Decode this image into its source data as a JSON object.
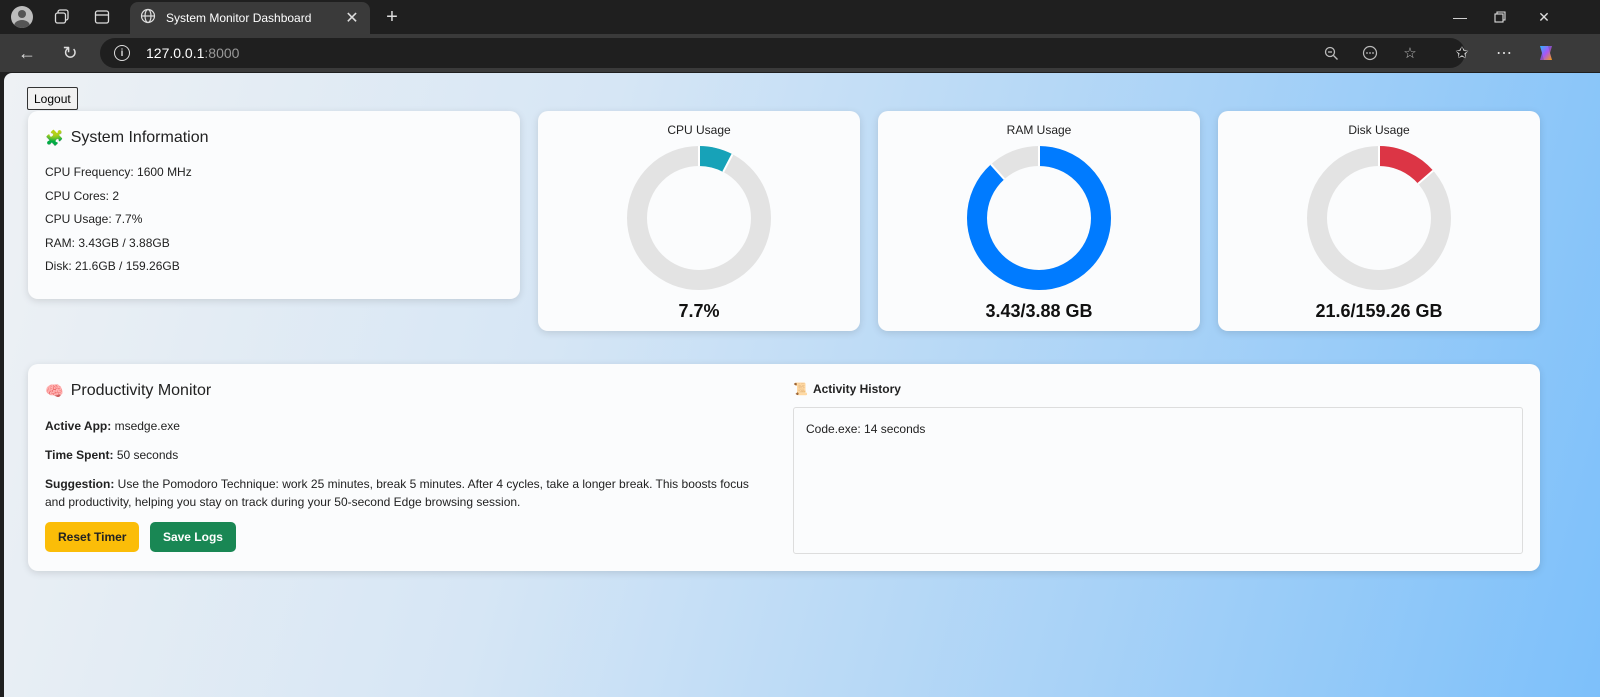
{
  "browser": {
    "tab_title": "System Monitor Dashboard",
    "url_host": "127.0.0.1",
    "url_port": ":8000"
  },
  "page": {
    "logout_label": "Logout",
    "system_info": {
      "title": "System Information",
      "title_icon": "puzzle-piece-icon",
      "lines": [
        "CPU Frequency: 1600 MHz",
        "CPU Cores: 2",
        "CPU Usage: 7.7%",
        "RAM: 3.43GB / 3.88GB",
        "Disk: 21.6GB / 159.26GB"
      ]
    },
    "gauges": [
      {
        "title": "CPU Usage",
        "value_label": "7.7%",
        "fraction": 0.077,
        "color": "#17a2b8"
      },
      {
        "title": "RAM Usage",
        "value_label": "3.43/3.88 GB",
        "fraction": 0.884,
        "color": "#007bff"
      },
      {
        "title": "Disk Usage",
        "value_label": "21.6/159.26 GB",
        "fraction": 0.1356,
        "color": "#dc3545"
      }
    ],
    "productivity": {
      "title": "Productivity Monitor",
      "title_icon": "brain-icon",
      "active_app_label": "Active App:",
      "active_app_value": "msedge.exe",
      "time_spent_label": "Time Spent:",
      "time_spent_value": "50 seconds",
      "suggestion_label": "Suggestion:",
      "suggestion_value": "Use the Pomodoro Technique: work 25 minutes, break 5 minutes. After 4 cycles, take a longer break. This boosts focus and productivity, helping you stay on track during your 50-second Edge browsing session.",
      "reset_label": "Reset Timer",
      "save_label": "Save Logs",
      "history_title": "Activity History",
      "history_icon": "scroll-icon",
      "history_entries": [
        "Code.exe: 14 seconds"
      ]
    }
  },
  "colors": {
    "ring_track": "#e3e3e3",
    "reset_button": "#fbbd08",
    "save_button": "#198754"
  }
}
